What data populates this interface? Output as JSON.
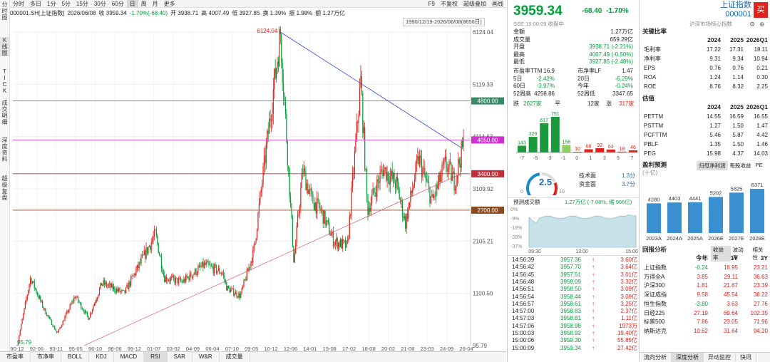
{
  "left_tabs": [
    "分时图",
    "K线图",
    "TICK",
    "成交明细",
    "深度资料",
    "超级复盘"
  ],
  "period_tabs": [
    "分时",
    "多日",
    "1分",
    "5分",
    "15分",
    "30分",
    "60分",
    "日",
    "周",
    "月",
    "更多"
  ],
  "period_selected": "日",
  "toolbar_right": {
    "f9": "F9",
    "adjust": "不复权",
    "overlay": "超级叠加",
    "draw": "画线"
  },
  "info": {
    "code": "000001.SH[上证指数]",
    "date": "2026/06/08",
    "close": "收 3959.34",
    "change": "-1.70%(-68.40)",
    "open": "开 3938.71",
    "high": "高 4007.49",
    "low": "低 3927.85",
    "turnover": "换 1.39%",
    "amp": "振 1.98%",
    "vol": "额 1.27万亿"
  },
  "date_range": "1990/12/19-2026/06/08(8656日)",
  "price_ticks": [
    "6124.04",
    "5119.33",
    "4114.63",
    "3109.92",
    "2105.21",
    "1100.50",
    "95.79"
  ],
  "x_ticks": [
    "90-12",
    "92-06",
    "93-11",
    "95-05",
    "96-10",
    "98-06",
    "99-12",
    "01-07",
    "03-02",
    "04-09",
    "06-04",
    "07-10",
    "09-05",
    "10-12",
    "12-06",
    "14-01",
    "15-08",
    "17-02",
    "18-08",
    "20-02",
    "21-08",
    "23-03",
    "24-09",
    "26-04"
  ],
  "hlines": [
    {
      "value": "4800.00",
      "color": "#3a8a6a"
    },
    {
      "value": "4050.00",
      "color": "#d030d0"
    },
    {
      "value": "3400.00",
      "color": "#c0303a"
    },
    {
      "value": "2700.00",
      "color": "#8a4a20"
    }
  ],
  "chart_annotations": {
    "high": "6124.04",
    "low": "95.79"
  },
  "bottom_tabs": [
    "市盈率",
    "市净率",
    "BOLL",
    "KDJ",
    "MACD",
    "RSI",
    "SAR",
    "W&R",
    "成交量"
  ],
  "bottom_selected": "RSI",
  "quote": {
    "price": "3959.34",
    "change": "-68.40",
    "pct": "-1.70%",
    "name": "上证指数",
    "code": "000001",
    "sub": "SSE 15:00:09 收盘中",
    "market": "沪深市场核心指数",
    "buy_btn": "买"
  },
  "stats": [
    [
      "金额",
      "1.27万亿"
    ],
    [
      "成交量",
      "659.29亿"
    ],
    [
      "开盘",
      "3938.71 (-2.21%)"
    ],
    [
      "最高",
      "4007.49 (-0.50%)"
    ],
    [
      "最低",
      "3927.85 (-2.48%)"
    ]
  ],
  "stats2": [
    [
      "市盈率TTM",
      "16.9",
      "市净率LF",
      "1.47"
    ],
    [
      "5日",
      "-2.42%",
      "20日",
      "-6.29%"
    ],
    [
      "60日",
      "-3.97%",
      "今年",
      "-0.24%"
    ],
    [
      "52周高",
      "4258.86",
      "52周低",
      "3347.65"
    ]
  ],
  "breadth": {
    "down_label": "跌",
    "down": "2027家",
    "flat_label": "平",
    "flat": "12家",
    "up_label": "涨",
    "up": "317家"
  },
  "dist": {
    "labels": [
      "143",
      "329",
      "617",
      "751",
      "158",
      "10",
      "68",
      "92",
      "63",
      "18",
      "46"
    ],
    "values": [
      143,
      329,
      617,
      751,
      158,
      10,
      68,
      92,
      63,
      18,
      46
    ],
    "axis": [
      "-7",
      "-5",
      "-3",
      "-1",
      "0",
      "1",
      "3",
      "5",
      "7"
    ]
  },
  "gauge": {
    "value": "2.5",
    "min": "0",
    "max": "10",
    "tech_label": "技术面",
    "tech": "1.3分",
    "fund_label": "资金面",
    "fund": "3.7分"
  },
  "forecast": {
    "label": "预测成交额",
    "val": "1.27万亿 (-7.08%, 缩 966亿)",
    "yticks": [
      "0%",
      "-9%",
      "-18%",
      "-28%",
      "-37%"
    ],
    "xticks": [
      "09:30",
      "13:00",
      "15:00"
    ]
  },
  "ticks": [
    [
      "14:56:39",
      "3957.36",
      "3.60亿"
    ],
    [
      "14:56:42",
      "3957.70",
      "3.64亿"
    ],
    [
      "14:56:45",
      "3957.51",
      "3.01亿"
    ],
    [
      "14:56:48",
      "3958.09",
      "3.32亿"
    ],
    [
      "14:56:51",
      "3958.50",
      "3.09亿"
    ],
    [
      "14:56:54",
      "3958.44",
      "3.09亿"
    ],
    [
      "14:56:57",
      "3958.61",
      "3.25亿"
    ],
    [
      "14:57:00",
      "3958.83",
      "2.37亿"
    ],
    [
      "14:57:03",
      "3958.81",
      "1.11亿"
    ],
    [
      "14:57:06",
      "3958.98",
      "1973万"
    ],
    [
      "15:00:03",
      "3958.92",
      "19.40亿"
    ],
    [
      "15:00:06",
      "3959.30",
      "55.85亿"
    ],
    [
      "15:00:09",
      "3959.34",
      "27.42亿"
    ]
  ],
  "ratios": {
    "title": "关键比率",
    "years": [
      "2024",
      "2025",
      "2026Q1"
    ],
    "rows": [
      [
        "毛利率",
        "17.22",
        "17.31",
        "18.11"
      ],
      [
        "净利率",
        "9.31",
        "9.34",
        "10.94"
      ],
      [
        "EPS",
        "0.76",
        "0.76",
        "0.21"
      ],
      [
        "ROA",
        "1.24",
        "1.14",
        "0.30"
      ],
      [
        "ROE",
        "8.76",
        "8.32",
        "2.25"
      ]
    ]
  },
  "valuation": {
    "title": "估值",
    "years": [
      "2024",
      "2025",
      "2026Q1"
    ],
    "rows": [
      [
        "PETTM",
        "14.55",
        "16.59",
        "16.55"
      ],
      [
        "PSTTM",
        "1.27",
        "1.50",
        "1.47"
      ],
      [
        "PCFTTM",
        "5.46",
        "5.87",
        "4.42"
      ],
      [
        "PBLF",
        "1.35",
        "1.50",
        "1.46"
      ],
      [
        "PEG",
        "15.98",
        "4.37",
        "14.03"
      ]
    ]
  },
  "profit": {
    "title": "盈利预测",
    "tabs": [
      "归母净利润",
      "每股收益",
      "PE"
    ],
    "unit": "(十亿)",
    "bars": [
      {
        "year": "2023A",
        "value": 4280,
        "label": "4280"
      },
      {
        "year": "2024A",
        "value": 4403,
        "label": "4403"
      },
      {
        "year": "2025A",
        "value": 4441,
        "label": "4441"
      },
      {
        "year": "2026E",
        "value": 5202,
        "label": "5202"
      },
      {
        "year": "2027E",
        "value": 5825,
        "label": "5825"
      },
      {
        "year": "2028E",
        "value": 6371,
        "label": "6371"
      }
    ]
  },
  "returns": {
    "title": "回报分析",
    "tabs": [
      "收益率",
      "波动率",
      "相关性"
    ],
    "cols": [
      "今年",
      "1Y",
      "3Y"
    ],
    "rows": [
      [
        "上证指数",
        "-0.24",
        "16.95",
        "23.21"
      ],
      [
        "万得全A",
        "3.85",
        "29.11",
        "36.63"
      ],
      [
        "沪深300",
        "1.81",
        "21.67",
        "23.39"
      ],
      [
        "深证成指",
        "9.58",
        "45.54",
        "38.22"
      ],
      [
        "恒生指数",
        "-3.80",
        "3.63",
        "27.76"
      ],
      [
        "日经225",
        "27.19",
        "69.64",
        "102.35"
      ],
      [
        "标普500",
        "7.86",
        "23.05",
        "71.96"
      ],
      [
        "纳斯达克",
        "10.62",
        "31.64",
        "94.20"
      ]
    ]
  },
  "right_bottom_tabs": [
    "流向分析",
    "深度分析",
    "异动监控",
    "快讯"
  ],
  "right_bottom_selected": "深度分析",
  "colors": {
    "up": "#e0221c",
    "down": "#00a03a",
    "trend": "#3344cc"
  }
}
